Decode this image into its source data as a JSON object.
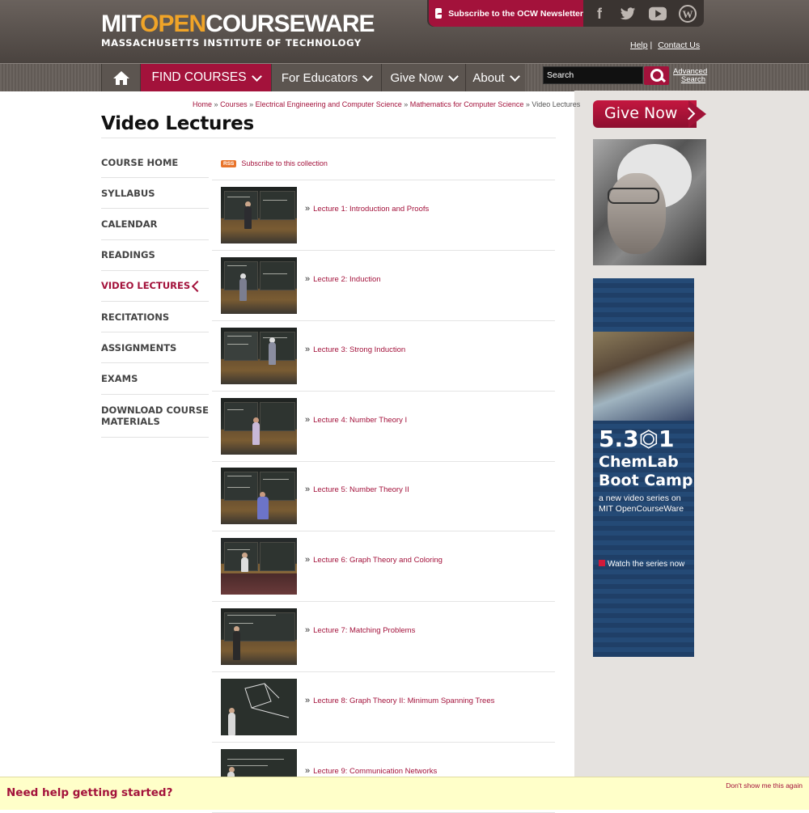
{
  "header": {
    "logo_mit": "MIT",
    "logo_open": "OPEN",
    "logo_courseware": "COURSEWARE",
    "logo_sub": "MASSACHUSETTS INSTITUTE OF TECHNOLOGY",
    "newsletter": "Subscribe to the OCW Newsletter",
    "help": "Help",
    "separator": "|",
    "contact": "Contact Us",
    "social_icons": [
      "facebook-icon",
      "twitter-icon",
      "youtube-icon",
      "wordpress-icon"
    ],
    "brand_color": "#a3123b",
    "accent_color": "#f0a428"
  },
  "nav": {
    "find_courses": "FIND COURSES",
    "for_educators": "For Educators",
    "give_now": "Give Now",
    "about": "About",
    "search_placeholder": "Search",
    "advanced": "Advanced",
    "search_label": "Search"
  },
  "breadcrumb": {
    "items": [
      "Home",
      "Courses",
      "Electrical Engineering and Computer Science",
      "Mathematics for Computer Science"
    ],
    "sep": "»",
    "current": "Video Lectures"
  },
  "page": {
    "title": "Video Lectures",
    "rss_badge": "RSS",
    "rss_text": "Subscribe to this collection"
  },
  "leftnav": [
    "COURSE HOME",
    "SYLLABUS",
    "CALENDAR",
    "READINGS",
    "VIDEO LECTURES",
    "RECITATIONS",
    "ASSIGNMENTS",
    "EXAMS",
    "DOWNLOAD COURSE MATERIALS"
  ],
  "lectures": [
    "Lecture 1: Introduction and Proofs",
    "Lecture 2: Induction",
    "Lecture 3: Strong Induction",
    "Lecture 4: Number Theory I",
    "Lecture 5: Number Theory II",
    "Lecture 6: Graph Theory and Coloring",
    "Lecture 7: Matching Problems",
    "Lecture 8: Graph Theory II: Minimum Spanning Trees",
    "Lecture 9: Communication Networks"
  ],
  "sidebar": {
    "give_now": "Give Now",
    "chem_num": "5.3⏣1",
    "chem_name1": "ChemLab",
    "chem_name2": "Boot Camp",
    "chem_sub1": "a new video series on",
    "chem_sub2": "MIT OpenCourseWare",
    "chem_watch": "Watch the series now"
  },
  "helpbar": {
    "text": "Need help getting started?",
    "dismiss": "Don't show me this again"
  }
}
